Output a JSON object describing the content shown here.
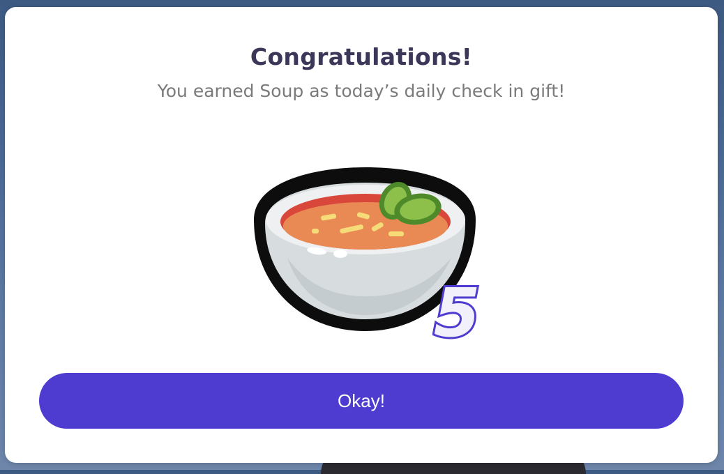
{
  "dialog": {
    "title": "Congratulations!",
    "message": "You earned Soup as today’s daily check in gift!",
    "reward": {
      "icon": "soup-bowl-icon",
      "quantity": "5"
    },
    "confirm_label": "Okay!"
  },
  "colors": {
    "button": "#4d3ccf",
    "title": "#3b3759",
    "message": "#7a7a7a",
    "quantity_fill": "#f2f0fb",
    "quantity_stroke": "#4d3ccf"
  }
}
